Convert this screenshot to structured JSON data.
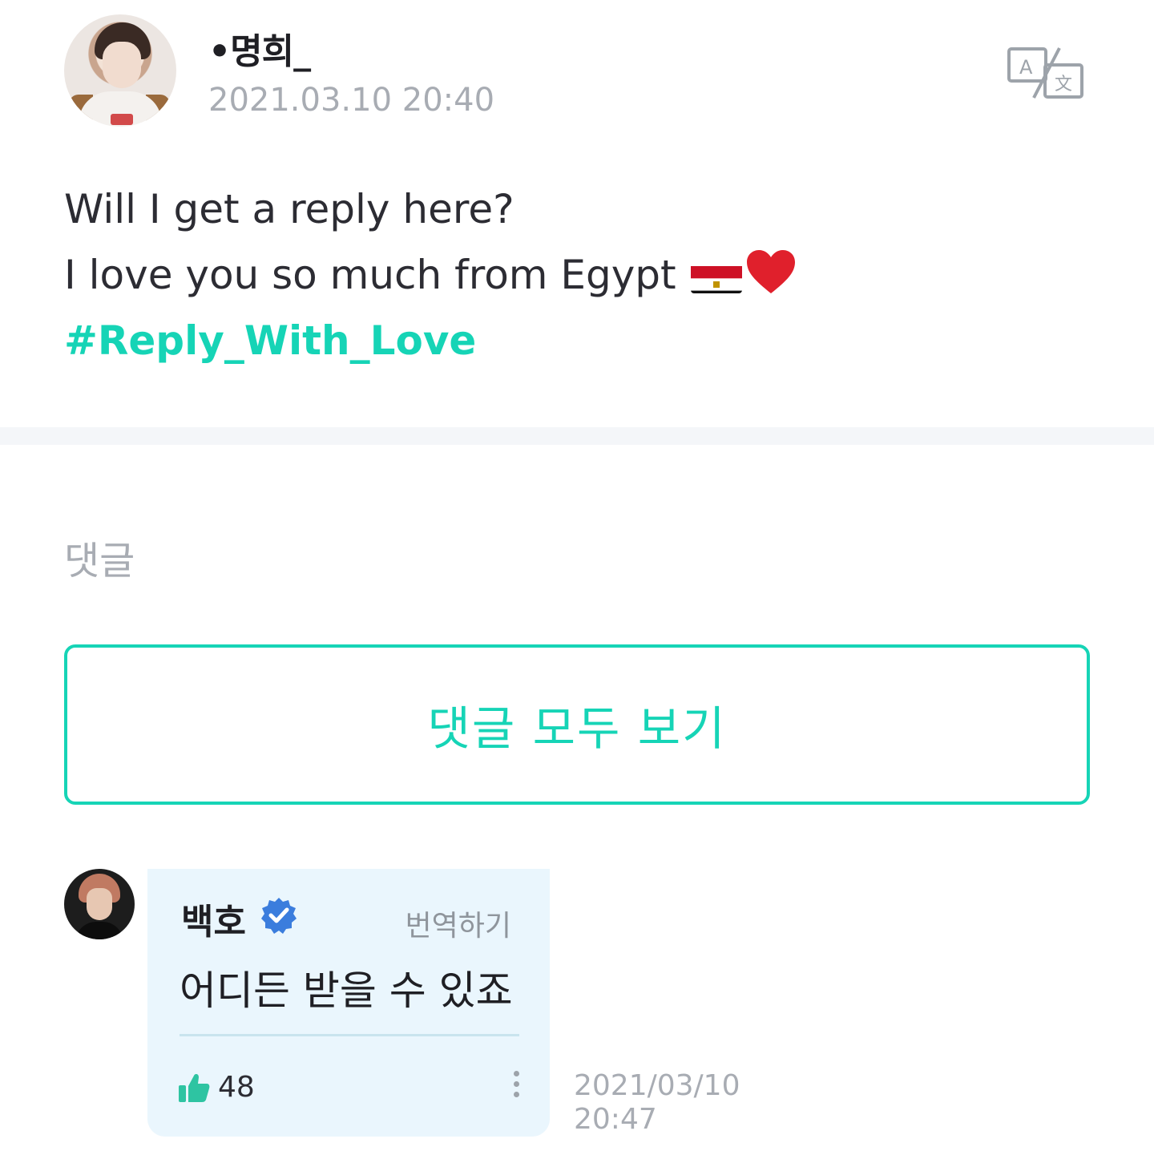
{
  "post": {
    "author": "•명희_",
    "date": "2021.03.10 20:40",
    "line1": "Will I get a reply here?",
    "line2": "I love you so much from Egypt",
    "hashtag": "#Reply_With_Love"
  },
  "icons": {
    "translate": "translate-icon",
    "flag": "egypt-flag-emoji",
    "heart": "red-heart-emoji",
    "verified": "verified-badge-icon",
    "like": "thumbs-up-icon",
    "more": "more-vertical-icon"
  },
  "comments": {
    "label": "댓글",
    "view_all_label": "댓글 모두 보기"
  },
  "reply": {
    "author": "백호",
    "translate_label": "번역하기",
    "text": "어디든 받을 수 있죠",
    "likes": "48",
    "date_line1": "2021/03/10",
    "date_line2": "20:47"
  },
  "colors": {
    "accent": "#16d4b6",
    "muted_text": "#a8acb3",
    "reply_bg": "#eaf6fd",
    "verified": "#3b7ddd"
  }
}
